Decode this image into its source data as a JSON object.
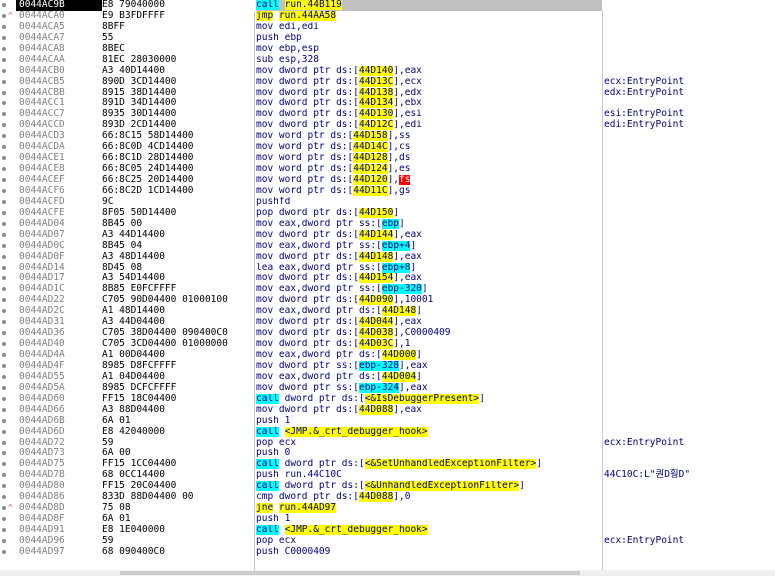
{
  "rows": [
    {
      "addr": "0044AC9B",
      "bytes": "E8 79040000",
      "mn": "call",
      "ops": [
        {
          "t": " run.44B119",
          "h": "call"
        }
      ],
      "cmt": "",
      "sel": true
    },
    {
      "addr": "0044ACA0",
      "bytes": "E9 B3FDFFFF",
      "mn": "jmp",
      "ops": [
        {
          "t": " run.44AA58",
          "h": "jmp"
        }
      ],
      "cmt": "",
      "jmpArrow": true
    },
    {
      "addr": "0044ACA5",
      "bytes": "8BFF",
      "mn": "mov",
      "ops": [
        {
          "t": " edi,edi"
        }
      ],
      "cmt": ""
    },
    {
      "addr": "0044ACA7",
      "bytes": "55",
      "mn": "push",
      "ops": [
        {
          "t": " ebp"
        }
      ],
      "cmt": ""
    },
    {
      "addr": "0044ACA8",
      "bytes": "8BEC",
      "mn": "mov",
      "ops": [
        {
          "t": " ebp,esp"
        }
      ],
      "cmt": ""
    },
    {
      "addr": "0044ACAA",
      "bytes": "81EC 28030000",
      "mn": "sub",
      "ops": [
        {
          "t": " esp,328"
        }
      ],
      "cmt": ""
    },
    {
      "addr": "0044ACB0",
      "bytes": "A3 40D14400",
      "mn": "mov",
      "ops": [
        {
          "t": " dword ptr ds:["
        },
        {
          "t": "44D140",
          "h": "y"
        },
        {
          "t": "],eax"
        }
      ],
      "cmt": ""
    },
    {
      "addr": "0044ACB5",
      "bytes": "890D 3CD14400",
      "mn": "mov",
      "ops": [
        {
          "t": " dword ptr ds:["
        },
        {
          "t": "44D13C",
          "h": "y"
        },
        {
          "t": "],ecx"
        }
      ],
      "cmt": "ecx:EntryPoint"
    },
    {
      "addr": "0044ACBB",
      "bytes": "8915 38D14400",
      "mn": "mov",
      "ops": [
        {
          "t": " dword ptr ds:["
        },
        {
          "t": "44D138",
          "h": "y"
        },
        {
          "t": "],edx"
        }
      ],
      "cmt": "edx:EntryPoint"
    },
    {
      "addr": "0044ACC1",
      "bytes": "891D 34D14400",
      "mn": "mov",
      "ops": [
        {
          "t": " dword ptr ds:["
        },
        {
          "t": "44D134",
          "h": "y"
        },
        {
          "t": "],ebx"
        }
      ],
      "cmt": ""
    },
    {
      "addr": "0044ACC7",
      "bytes": "8935 30D14400",
      "mn": "mov",
      "ops": [
        {
          "t": " dword ptr ds:["
        },
        {
          "t": "44D130",
          "h": "y"
        },
        {
          "t": "],esi"
        }
      ],
      "cmt": "esi:EntryPoint"
    },
    {
      "addr": "0044ACCD",
      "bytes": "893D 2CD14400",
      "mn": "mov",
      "ops": [
        {
          "t": " dword ptr ds:["
        },
        {
          "t": "44D12C",
          "h": "y"
        },
        {
          "t": "],edi"
        }
      ],
      "cmt": "edi:EntryPoint"
    },
    {
      "addr": "0044ACD3",
      "bytes": "66:8C15 58D14400",
      "mn": "mov",
      "ops": [
        {
          "t": " word ptr ds:["
        },
        {
          "t": "44D158",
          "h": "y"
        },
        {
          "t": "],ss"
        }
      ],
      "cmt": ""
    },
    {
      "addr": "0044ACDA",
      "bytes": "66:8C0D 4CD14400",
      "mn": "mov",
      "ops": [
        {
          "t": " word ptr ds:["
        },
        {
          "t": "44D14C",
          "h": "y"
        },
        {
          "t": "],cs"
        }
      ],
      "cmt": ""
    },
    {
      "addr": "0044ACE1",
      "bytes": "66:8C1D 28D14400",
      "mn": "mov",
      "ops": [
        {
          "t": " word ptr ds:["
        },
        {
          "t": "44D128",
          "h": "y"
        },
        {
          "t": "],ds"
        }
      ],
      "cmt": ""
    },
    {
      "addr": "0044ACE8",
      "bytes": "66:8C05 24D14400",
      "mn": "mov",
      "ops": [
        {
          "t": " word ptr ds:["
        },
        {
          "t": "44D124",
          "h": "y"
        },
        {
          "t": "],es"
        }
      ],
      "cmt": ""
    },
    {
      "addr": "0044ACEF",
      "bytes": "66:8C25 20D14400",
      "mn": "mov",
      "ops": [
        {
          "t": " word ptr ds:["
        },
        {
          "t": "44D120",
          "h": "y"
        },
        {
          "t": "],"
        },
        {
          "t": "fs",
          "h": "r"
        }
      ],
      "cmt": ""
    },
    {
      "addr": "0044ACF6",
      "bytes": "66:8C2D 1CD14400",
      "mn": "mov",
      "ops": [
        {
          "t": " word ptr ds:["
        },
        {
          "t": "44D11C",
          "h": "y"
        },
        {
          "t": "],gs"
        }
      ],
      "cmt": ""
    },
    {
      "addr": "0044ACFD",
      "bytes": "9C",
      "mn": "pushfd",
      "ops": [],
      "cmt": ""
    },
    {
      "addr": "0044ACFE",
      "bytes": "8F05 50D14400",
      "mn": "pop",
      "ops": [
        {
          "t": " dword ptr ds:["
        },
        {
          "t": "44D150",
          "h": "y"
        },
        {
          "t": "]"
        }
      ],
      "cmt": ""
    },
    {
      "addr": "0044AD04",
      "bytes": "8B45 00",
      "mn": "mov",
      "ops": [
        {
          "t": " eax,dword ptr ss:["
        },
        {
          "t": "ebp",
          "h": "c"
        },
        {
          "t": "]"
        }
      ],
      "cmt": ""
    },
    {
      "addr": "0044AD07",
      "bytes": "A3 44D14400",
      "mn": "mov",
      "ops": [
        {
          "t": " dword ptr ds:["
        },
        {
          "t": "44D144",
          "h": "y"
        },
        {
          "t": "],eax"
        }
      ],
      "cmt": ""
    },
    {
      "addr": "0044AD0C",
      "bytes": "8B45 04",
      "mn": "mov",
      "ops": [
        {
          "t": " eax,dword ptr ss:["
        },
        {
          "t": "ebp+4",
          "h": "c"
        },
        {
          "t": "]"
        }
      ],
      "cmt": ""
    },
    {
      "addr": "0044AD0F",
      "bytes": "A3 48D14400",
      "mn": "mov",
      "ops": [
        {
          "t": " dword ptr ds:["
        },
        {
          "t": "44D148",
          "h": "y"
        },
        {
          "t": "],eax"
        }
      ],
      "cmt": ""
    },
    {
      "addr": "0044AD14",
      "bytes": "8D45 08",
      "mn": "lea",
      "ops": [
        {
          "t": " eax,dword ptr ss:["
        },
        {
          "t": "ebp+8",
          "h": "c"
        },
        {
          "t": "]"
        }
      ],
      "cmt": ""
    },
    {
      "addr": "0044AD17",
      "bytes": "A3 54D14400",
      "mn": "mov",
      "ops": [
        {
          "t": " dword ptr ds:["
        },
        {
          "t": "44D154",
          "h": "y"
        },
        {
          "t": "],eax"
        }
      ],
      "cmt": ""
    },
    {
      "addr": "0044AD1C",
      "bytes": "8B85 E0FCFFFF",
      "mn": "mov",
      "ops": [
        {
          "t": " eax,dword ptr ss:["
        },
        {
          "t": "ebp-320",
          "h": "c"
        },
        {
          "t": "]"
        }
      ],
      "cmt": ""
    },
    {
      "addr": "0044AD22",
      "bytes": "C705 90D04400 01000100",
      "mn": "mov",
      "ops": [
        {
          "t": " dword ptr ds:["
        },
        {
          "t": "44D090",
          "h": "y"
        },
        {
          "t": "],10001"
        }
      ],
      "cmt": ""
    },
    {
      "addr": "0044AD2C",
      "bytes": "A1 48D14400",
      "mn": "mov",
      "ops": [
        {
          "t": " eax,dword ptr ds:["
        },
        {
          "t": "44D148",
          "h": "y"
        },
        {
          "t": "]"
        }
      ],
      "cmt": ""
    },
    {
      "addr": "0044AD31",
      "bytes": "A3 44D04400",
      "mn": "mov",
      "ops": [
        {
          "t": " dword ptr ds:["
        },
        {
          "t": "44D044",
          "h": "y"
        },
        {
          "t": "],eax"
        }
      ],
      "cmt": ""
    },
    {
      "addr": "0044AD36",
      "bytes": "C705 38D04400 090400C0",
      "mn": "mov",
      "ops": [
        {
          "t": " dword ptr ds:["
        },
        {
          "t": "44D038",
          "h": "y"
        },
        {
          "t": "],C0000409"
        }
      ],
      "cmt": ""
    },
    {
      "addr": "0044AD40",
      "bytes": "C705 3CD04400 01000000",
      "mn": "mov",
      "ops": [
        {
          "t": " dword ptr ds:["
        },
        {
          "t": "44D03C",
          "h": "y"
        },
        {
          "t": "],1"
        }
      ],
      "cmt": ""
    },
    {
      "addr": "0044AD4A",
      "bytes": "A1 00D04400",
      "mn": "mov",
      "ops": [
        {
          "t": " eax,dword ptr ds:["
        },
        {
          "t": "44D000",
          "h": "y"
        },
        {
          "t": "]"
        }
      ],
      "cmt": ""
    },
    {
      "addr": "0044AD4F",
      "bytes": "8985 D8FCFFFF",
      "mn": "mov",
      "ops": [
        {
          "t": " dword ptr ss:["
        },
        {
          "t": "ebp-328",
          "h": "c"
        },
        {
          "t": "],eax"
        }
      ],
      "cmt": ""
    },
    {
      "addr": "0044AD55",
      "bytes": "A1 04D04400",
      "mn": "mov",
      "ops": [
        {
          "t": " eax,dword ptr ds:["
        },
        {
          "t": "44D004",
          "h": "y"
        },
        {
          "t": "]"
        }
      ],
      "cmt": ""
    },
    {
      "addr": "0044AD5A",
      "bytes": "8985 DCFCFFFF",
      "mn": "mov",
      "ops": [
        {
          "t": " dword ptr ss:["
        },
        {
          "t": "ebp-324",
          "h": "c"
        },
        {
          "t": "],eax"
        }
      ],
      "cmt": ""
    },
    {
      "addr": "0044AD60",
      "bytes": "FF15 18C04400",
      "mn": "call",
      "ops": [
        {
          "t": " dword ptr ds:["
        },
        {
          "t": "<&IsDebuggerPresent>",
          "h": "y"
        },
        {
          "t": "]"
        }
      ],
      "cmt": "",
      "mnHl": "call"
    },
    {
      "addr": "0044AD66",
      "bytes": "A3 88D04400",
      "mn": "mov",
      "ops": [
        {
          "t": " dword ptr ds:["
        },
        {
          "t": "44D088",
          "h": "y"
        },
        {
          "t": "],eax"
        }
      ],
      "cmt": ""
    },
    {
      "addr": "0044AD6B",
      "bytes": "6A 01",
      "mn": "push",
      "ops": [
        {
          "t": " 1"
        }
      ],
      "cmt": ""
    },
    {
      "addr": "0044AD6D",
      "bytes": "E8 42040000",
      "mn": "call",
      "ops": [
        {
          "t": " "
        },
        {
          "t": "<JMP.&_crt_debugger_hook>",
          "h": "y"
        }
      ],
      "cmt": "",
      "mnHl": "call"
    },
    {
      "addr": "0044AD72",
      "bytes": "59",
      "mn": "pop",
      "ops": [
        {
          "t": " ecx"
        }
      ],
      "cmt": "ecx:EntryPoint"
    },
    {
      "addr": "0044AD73",
      "bytes": "6A 00",
      "mn": "push",
      "ops": [
        {
          "t": " 0"
        }
      ],
      "cmt": ""
    },
    {
      "addr": "0044AD75",
      "bytes": "FF15 1CC04400",
      "mn": "call",
      "ops": [
        {
          "t": " dword ptr ds:["
        },
        {
          "t": "<&SetUnhandledExceptionFilter>",
          "h": "y"
        },
        {
          "t": "]"
        }
      ],
      "cmt": "",
      "mnHl": "call"
    },
    {
      "addr": "0044AD7B",
      "bytes": "68 0CC14400",
      "mn": "push",
      "ops": [
        {
          "t": " run.44C10C"
        }
      ],
      "cmt": "44C10C:L\"퀀D훵D\""
    },
    {
      "addr": "0044AD80",
      "bytes": "FF15 20C04400",
      "mn": "call",
      "ops": [
        {
          "t": " dword ptr ds:["
        },
        {
          "t": "<&UnhandledExceptionFilter>",
          "h": "y"
        },
        {
          "t": "]"
        }
      ],
      "cmt": "",
      "mnHl": "call"
    },
    {
      "addr": "0044AD86",
      "bytes": "833D 88D04400 00",
      "mn": "cmp",
      "ops": [
        {
          "t": " dword ptr ds:["
        },
        {
          "t": "44D088",
          "h": "y"
        },
        {
          "t": "],0"
        }
      ],
      "cmt": ""
    },
    {
      "addr": "0044AD8D",
      "bytes": "75 08",
      "mn": "jne",
      "ops": [
        {
          "t": " run.44AD97",
          "h": "jmp"
        }
      ],
      "cmt": "",
      "mnHl": "jmp",
      "jmpArrow": true
    },
    {
      "addr": "0044AD8F",
      "bytes": "6A 01",
      "mn": "push",
      "ops": [
        {
          "t": " 1"
        }
      ],
      "cmt": ""
    },
    {
      "addr": "0044AD91",
      "bytes": "E8 1E040000",
      "mn": "call",
      "ops": [
        {
          "t": " "
        },
        {
          "t": "<JMP.&_crt_debugger_hook>",
          "h": "y"
        }
      ],
      "cmt": "",
      "mnHl": "call"
    },
    {
      "addr": "0044AD96",
      "bytes": "59",
      "mn": "pop",
      "ops": [
        {
          "t": " ecx"
        }
      ],
      "cmt": "ecx:EntryPoint"
    },
    {
      "addr": "0044AD97",
      "bytes": "68 090400C0",
      "mn": "push",
      "ops": [
        {
          "t": " C0000409"
        }
      ],
      "cmt": ""
    }
  ]
}
